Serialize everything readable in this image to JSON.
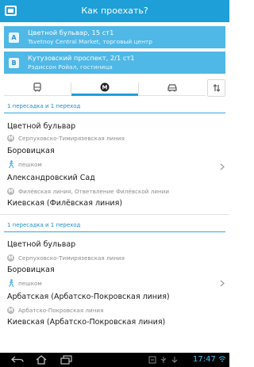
{
  "app": {
    "title": "Как проехать?",
    "accent_color": "#1f9fd8"
  },
  "from": {
    "badge": "A",
    "line1": "Цветной бульвар, 15 ст1",
    "line2": "Tsvetnoy Central Market, торговый центр"
  },
  "to": {
    "badge": "B",
    "line1": "Кутузовский проспект, 2/1 ст1",
    "line2": "Рэдиссон Ройал, гостиница"
  },
  "tabs": [
    {
      "icon": "bus-icon",
      "active": false
    },
    {
      "icon": "metro-icon",
      "active": true
    },
    {
      "icon": "car-icon",
      "active": false
    },
    {
      "icon": "swap-icon",
      "active": false
    }
  ],
  "routes": [
    {
      "title": "1 пересадка и 1 переход",
      "items": [
        {
          "kind": "station",
          "text": "Цветной бульвар"
        },
        {
          "kind": "metro",
          "text": "Серпуховско-Тимирязевская линия"
        },
        {
          "kind": "station",
          "text": "Боровицкая"
        },
        {
          "kind": "walk",
          "text": "пешком"
        },
        {
          "kind": "station",
          "text": "Александровский Сад"
        },
        {
          "kind": "metro",
          "text": "Филёвская линия, Ответвление Филёвской линии"
        },
        {
          "kind": "station",
          "text": "Киевская (Филёвская линия)"
        }
      ]
    },
    {
      "title": "1 пересадка и 1 переход",
      "items": [
        {
          "kind": "station",
          "text": "Цветной бульвар"
        },
        {
          "kind": "metro",
          "text": "Серпуховско-Тимирязевская линия"
        },
        {
          "kind": "station",
          "text": "Боровицкая"
        },
        {
          "kind": "walk",
          "text": "пешком"
        },
        {
          "kind": "station",
          "text": "Арбатская (Арбатско-Покровская линия)"
        },
        {
          "kind": "metro",
          "text": "Арбатско-Покровская линия"
        },
        {
          "kind": "station",
          "text": "Киевская (Арбатско-Покровская линия)"
        }
      ]
    }
  ],
  "metro_badge": "M",
  "status_bar": {
    "clock": "17:47"
  }
}
